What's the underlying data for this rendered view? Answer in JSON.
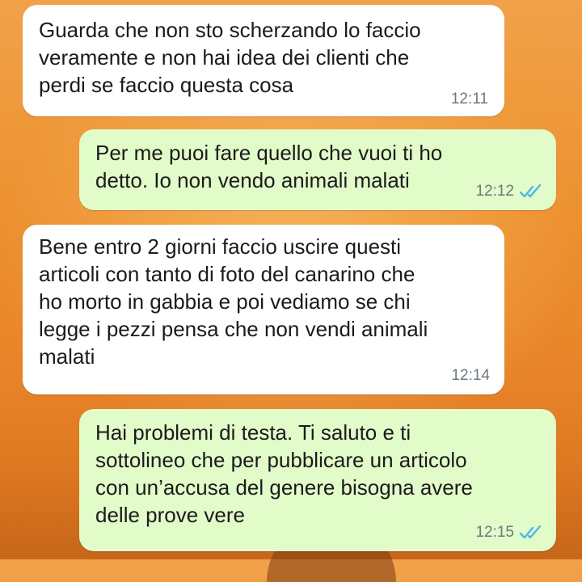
{
  "messages": [
    {
      "direction": "incoming",
      "text": "Guarda che non sto scherzando lo faccio\nveramente e non hai idea dei clienti che\nperdi se faccio questa cosa",
      "time": "12:11"
    },
    {
      "direction": "outgoing",
      "text": "Per me puoi fare quello che vuoi ti ho\ndetto. Io non vendo animali malati",
      "time": "12:12",
      "status_icon": "double-check-read-icon"
    },
    {
      "direction": "incoming",
      "text": "Bene entro 2 giorni faccio uscire questi\narticoli con tanto di foto del canarino che\nho morto in gabbia e poi vediamo se chi\nlegge i pezzi pensa che non vendi animali\nmalati",
      "time": "12:14"
    },
    {
      "direction": "outgoing",
      "text": "Hai problemi di testa. Ti saluto e ti\nsottolineo che per pubblicare un articolo\ncon un’accusa del genere bisogna avere\ndelle prove vere",
      "time": "12:15",
      "status_icon": "double-check-read-icon"
    }
  ],
  "colors": {
    "incoming_bubble": "#ffffff",
    "outgoing_bubble": "#e1fbc9",
    "read_check": "#4fb6ec",
    "timestamp": "#6b7a80",
    "background": "#ec8f2f"
  }
}
